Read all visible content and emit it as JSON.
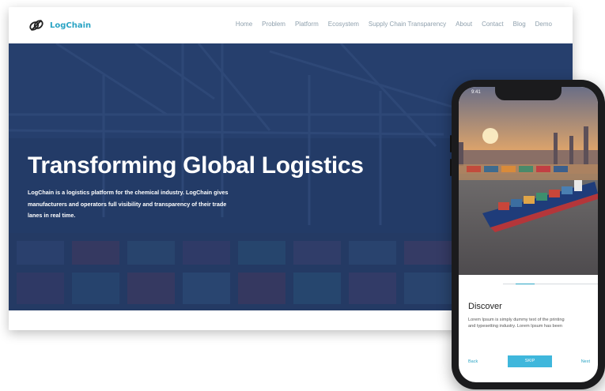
{
  "desktop": {
    "logo_text": "LogChain",
    "nav": [
      "Home",
      "Problem",
      "Platform",
      "Ecosystem",
      "Supply Chain Transparency",
      "About",
      "Contact",
      "Blog",
      "Demo"
    ],
    "hero_title": "Transforming Global Logistics",
    "hero_description": "LogChain is a logistics platform for the chemical industry. LogChain gives manufacturers and operators full visibility and transparency of their trade lanes in real time."
  },
  "mobile": {
    "status_time": "9:41",
    "slide_progress": 0.2,
    "discover_title": "Discover",
    "discover_text": "Lorem Ipsum is simply dummy text of the printing and typesetting industry. Lorem Ipsum has been",
    "back_label": "Back",
    "skip_label": "SKIP",
    "next_label": "Next"
  },
  "colors": {
    "accent": "#2aa4c4",
    "hero_bg": "#243a62",
    "button": "#3fb7dc"
  },
  "icons": [
    "logchain-logo-icon"
  ]
}
